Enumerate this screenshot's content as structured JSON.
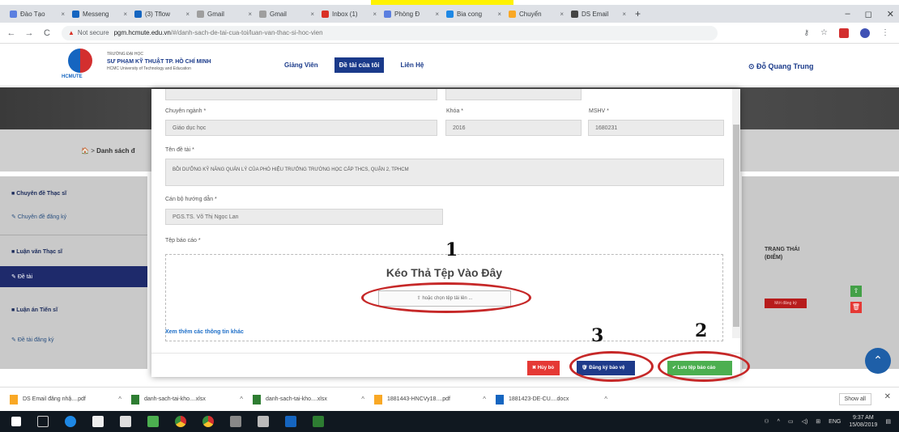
{
  "browser": {
    "tabs": [
      {
        "label": "Đào Tạo",
        "color": "#5b7fe0",
        "active": false
      },
      {
        "label": "Messeng",
        "color": "#1565c0",
        "active": false
      },
      {
        "label": "(3) Tflow",
        "color": "#1565c0",
        "active": false
      },
      {
        "label": "Gmail",
        "color": "#9e9e9e",
        "active": false
      },
      {
        "label": "Gmail",
        "color": "#9e9e9e",
        "active": false
      },
      {
        "label": "Inbox (1)",
        "color": "#d93025",
        "active": false
      },
      {
        "label": "Phòng Đ",
        "color": "#5b7fe0",
        "active": false
      },
      {
        "label": "Bia cong",
        "color": "#1e88e5",
        "active": false
      },
      {
        "label": "Chuyển",
        "color": "#f9a825",
        "active": false
      },
      {
        "label": "DS Email",
        "color": "#444",
        "active": false
      }
    ],
    "new_tab": "+",
    "window_controls": [
      "–",
      "◻",
      "✕"
    ],
    "security_warning": "▲",
    "not_secure": "Not secure",
    "url_host": "pgm.hcmute.edu.vn",
    "url_path": "/#/danh-sach-de-tai-cua-toi/luan-van-thac-si-hoc-vien"
  },
  "site": {
    "school_line1": "TRƯỜNG ĐẠI HỌC",
    "school_line2": "SƯ PHẠM KỸ THUẬT TP. HỒ CHÍ MINH",
    "school_line3": "HCMC University of Technology and Education",
    "logo_label": "HCMUTE",
    "menu": [
      "Giảng Viên",
      "Đề tài của tôi",
      "Liên Hệ"
    ],
    "user": "⊙ Đỗ Quang Trung"
  },
  "breadcrumb": {
    "home": "🏠",
    "separator": ">",
    "label": "Danh sách đ"
  },
  "sidebar": {
    "sections": [
      {
        "title": "Chuyên đề Thạc sĩ",
        "items": [
          "Chuyên đề đăng ký"
        ]
      },
      {
        "title": "Luận văn Thạc sĩ",
        "items": [
          "Đề tài"
        ]
      },
      {
        "title": "Luận án Tiến sĩ",
        "items": [
          "Đề tài đăng ký"
        ]
      }
    ]
  },
  "table": {
    "status_header_1": "TRẠNG THÁI",
    "status_header_2": "(ĐIỂM)",
    "status_badge": "Mới đăng ký"
  },
  "modal": {
    "labels": {
      "major": "Chuyên ngành *",
      "course": "Khóa *",
      "student_id": "MSHV *",
      "topic": "Tên đề tài *",
      "advisor": "Cán bộ hướng dẫn *",
      "report": "Tệp báo cáo *"
    },
    "values": {
      "major": "Giáo dục học",
      "course": "2016",
      "student_id": "1680231",
      "topic": "BỒI DƯỠNG KỸ NĂNG QUẢN LÝ CỦA PHÓ HIỆU TRƯỞNG TRƯỜNG HỌC CẤP THCS, QUẬN 2, TPHCM",
      "advisor": "PGS.TS. Võ Thị Ngọc Lan"
    },
    "dropzone_title": "Kéo Thả Tệp Vào Đây",
    "choose_file": "⇧  hoặc chọn tệp tải lên ...",
    "more_info": "Xem thêm các thông tin khác",
    "buttons": {
      "close": "✖ Hủy bỏ",
      "register": "🛡 Đăng ký bảo vệ",
      "save": "✔ Lưu tệp báo cáo"
    }
  },
  "annotations": [
    "1",
    "2",
    "3"
  ],
  "downloads": [
    {
      "name": "DS Email đăng nhậ....pdf",
      "color": "#f9a825"
    },
    {
      "name": "danh-sach-tai-kho....xlsx",
      "color": "#2e7d32"
    },
    {
      "name": "danh-sach-tai-kho....xlsx",
      "color": "#2e7d32"
    },
    {
      "name": "1881443-HNCVy18....pdf",
      "color": "#f9a825"
    },
    {
      "name": "1881423-DE-CU....docx",
      "color": "#1565c0"
    }
  ],
  "downloads_show_all": "Show all",
  "downloads_close": "✕",
  "taskbar": {
    "language": "ENG",
    "time": "9:37 AM",
    "date": "15/08/2019"
  }
}
